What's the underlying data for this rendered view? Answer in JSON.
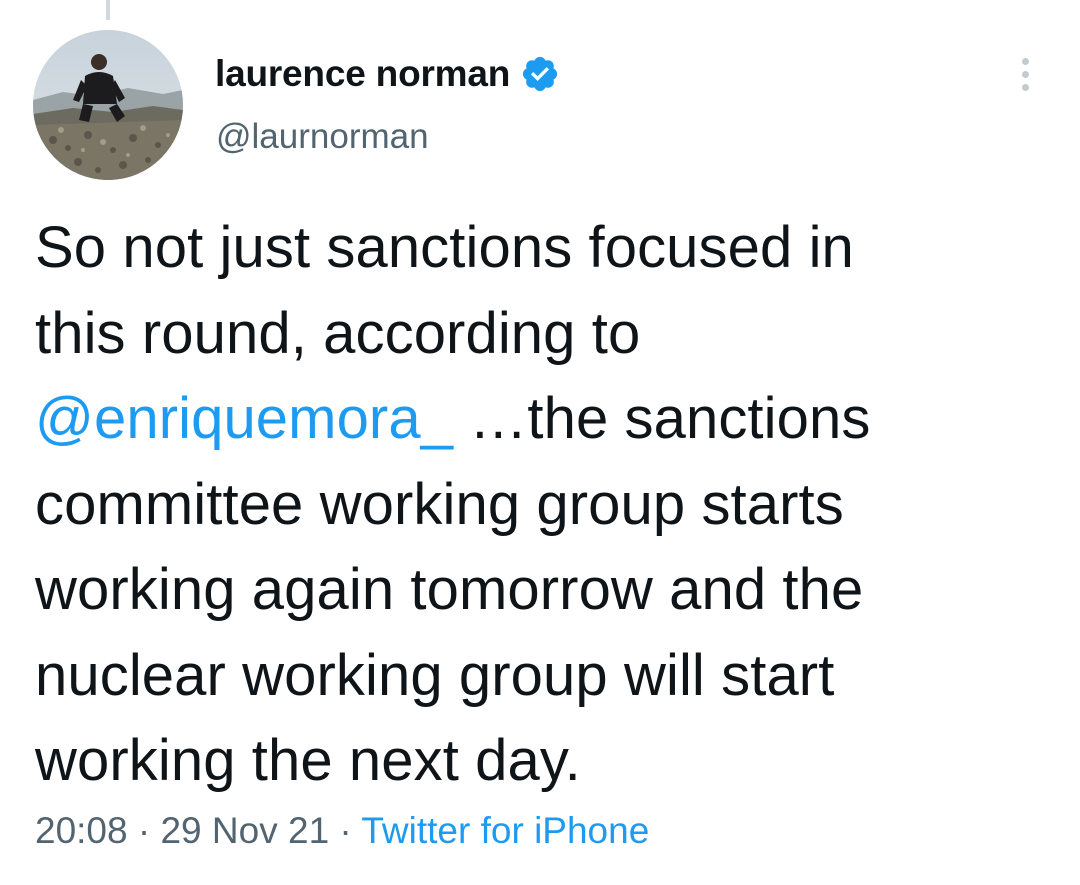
{
  "author": {
    "display_name": "laurence norman",
    "handle": "@laurnorman",
    "verified": true,
    "avatar_icon": "profile-photo"
  },
  "tweet": {
    "lines": [
      "So not just sanctions focused in",
      "this round, according to",
      "",
      "committee working group starts",
      "working again tomorrow and the",
      "nuclear working group will start",
      "working the next day."
    ],
    "mention": "@enriquemora_",
    "mention_line_rest": " …the sanctions"
  },
  "meta": {
    "time": "20:08",
    "separator": " · ",
    "date": "29 Nov 21",
    "source": "Twitter for iPhone"
  },
  "colors": {
    "link": "#1d9bf0",
    "text": "#0f1419",
    "secondary": "#536471"
  },
  "icons": {
    "verified": "verified-badge-icon",
    "more": "more-options-icon"
  }
}
